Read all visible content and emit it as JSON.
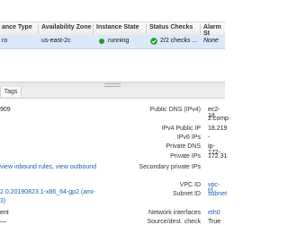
{
  "table": {
    "headers": [
      "ance Type",
      "Availability Zone",
      "Instance State",
      "Status Checks",
      "Alarm St"
    ],
    "row": {
      "type": "ro",
      "zone": "us-east-2c",
      "state": "running",
      "checks": "2/2 checks ...",
      "alarm": "None"
    }
  },
  "tabs": {
    "tags": "Tags"
  },
  "details": {
    "left": {
      "id_fragment": "909",
      "sg_links": "view inbound rules, view outbound",
      "sg_links_rest": "",
      "ami_line1": "2.0.20190823.1-x86_64-gp2 (ami-",
      "ami_line2": "3)",
      "network_fragment": "ent",
      "last": "—"
    },
    "right": [
      {
        "label": "Public DNS (IPv4)",
        "value": "ec2-18"
      },
      {
        "label": "",
        "value": "2.comp"
      },
      {
        "label": "IPv4 Public IP",
        "value": "18.219"
      },
      {
        "label": "IPv6 IPs",
        "value": "-"
      },
      {
        "label": "Private DNS",
        "value": "ip-172-"
      },
      {
        "label": "Private IPs",
        "value": "172.31"
      },
      {
        "label": "Secondary private IPs",
        "value": ""
      },
      {
        "label": "VPC ID",
        "value": "vpc-f3"
      },
      {
        "label": "Subnet ID",
        "value": "subnet"
      },
      {
        "label": "Network interfaces",
        "value": "eth0"
      },
      {
        "label": "Source/dest. check",
        "value": "True"
      }
    ]
  },
  "colors": {
    "selected_row": "#dbe8f8",
    "running_dot": "#1d9a2e",
    "link": "#1a5fb4"
  }
}
